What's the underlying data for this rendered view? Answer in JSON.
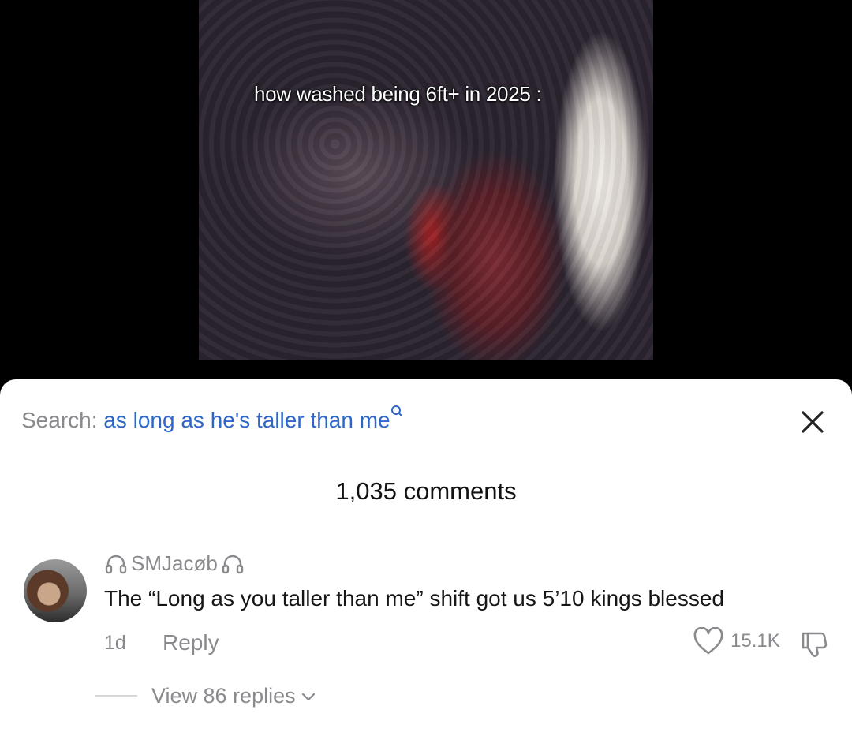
{
  "video": {
    "caption": "how washed being 6ft+ in 2025 :"
  },
  "search": {
    "prefix": "Search:",
    "term": "as long as he's taller than me",
    "icon": "search-icon"
  },
  "comments_header": {
    "count_label": "1,035 comments"
  },
  "comment": {
    "author": "SMJacøb",
    "author_icons": [
      "headphones-icon",
      "headphones-icon"
    ],
    "text": "The “Long as you taller than me” shift got us 5’10 kings blessed",
    "time": "1d",
    "reply_label": "Reply",
    "likes": "15.1K",
    "view_replies_label": "View 86 replies"
  },
  "colors": {
    "link_blue": "#2f66c7",
    "muted_gray": "#8a8a8e"
  }
}
